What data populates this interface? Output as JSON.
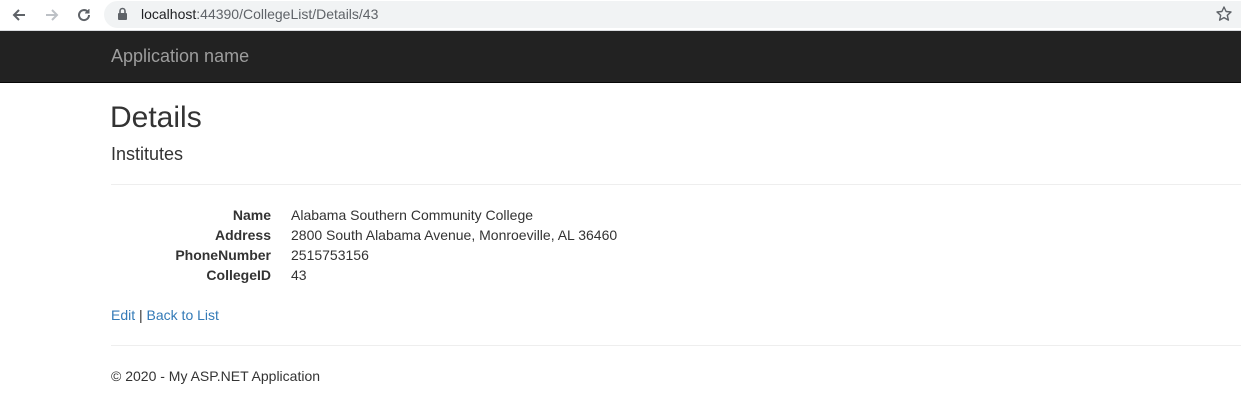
{
  "browser": {
    "url_host": "localhost",
    "url_path": ":44390/CollegeList/Details/43"
  },
  "navbar": {
    "brand": "Application name"
  },
  "page": {
    "title": "Details",
    "subtitle": "Institutes"
  },
  "details": [
    {
      "label": "Name",
      "value": "Alabama Southern Community College"
    },
    {
      "label": "Address",
      "value": "2800 South Alabama Avenue, Monroeville, AL 36460"
    },
    {
      "label": "PhoneNumber",
      "value": "2515753156"
    },
    {
      "label": "CollegeID",
      "value": "43"
    }
  ],
  "actions": {
    "edit": "Edit",
    "separator": "|",
    "back": "Back to List"
  },
  "footer": {
    "text": "© 2020 - My ASP.NET Application"
  },
  "colors": {
    "navbar_bg": "#222222",
    "brand": "#9d9d9d",
    "link": "#337ab7"
  }
}
